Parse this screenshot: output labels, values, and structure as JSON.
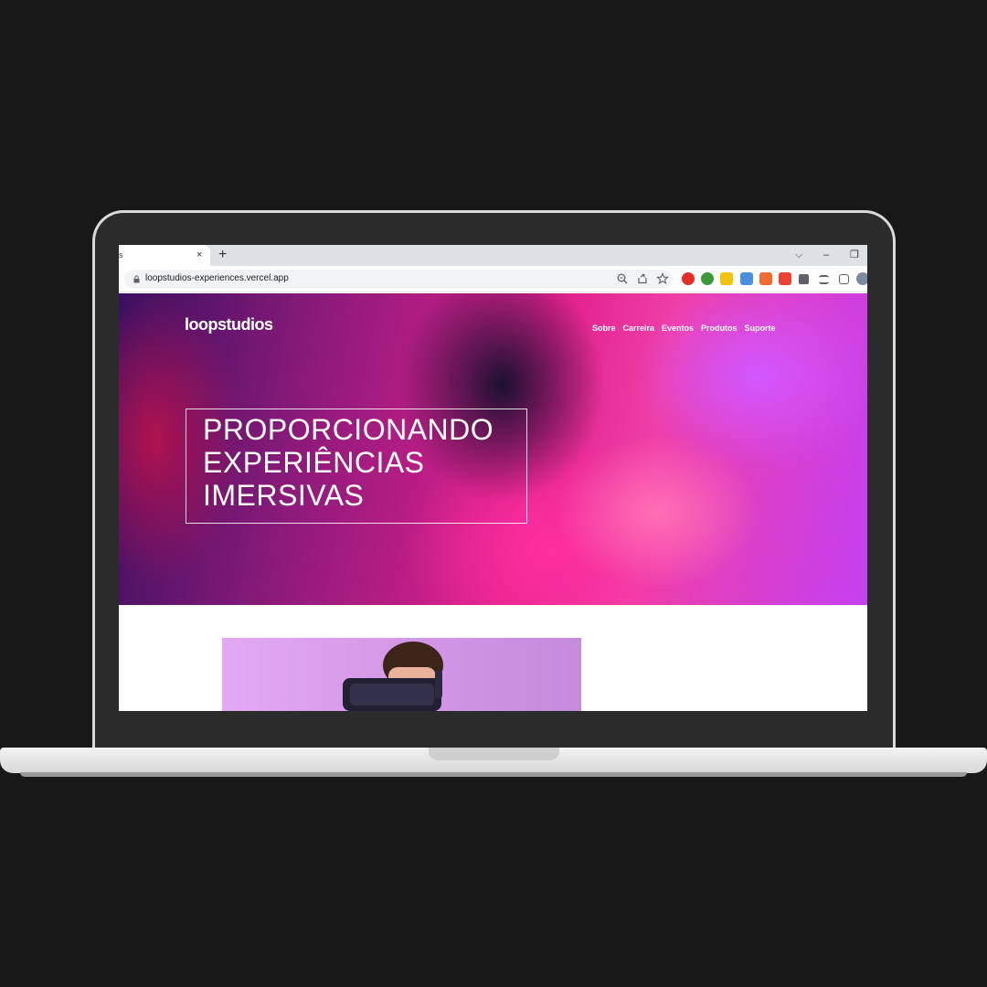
{
  "browser": {
    "tab_title": "s",
    "tab_close": "×",
    "new_tab": "+",
    "window_controls": {
      "menu": "⌵",
      "minimize": "–",
      "restore": "❐"
    },
    "url": "loopstudios-experiences.vercel.app"
  },
  "site": {
    "logo": "loopstudios",
    "nav": [
      "Sobre",
      "Carreira",
      "Eventos",
      "Produtos",
      "Suporte"
    ],
    "hero_lines": [
      "PROPORCIONANDO",
      "EXPERIÊNCIAS",
      "IMERSIVAS"
    ]
  },
  "colors": {
    "background": "#181818",
    "accent_pink": "#f03fa8",
    "accent_purple": "#c33ff0"
  }
}
